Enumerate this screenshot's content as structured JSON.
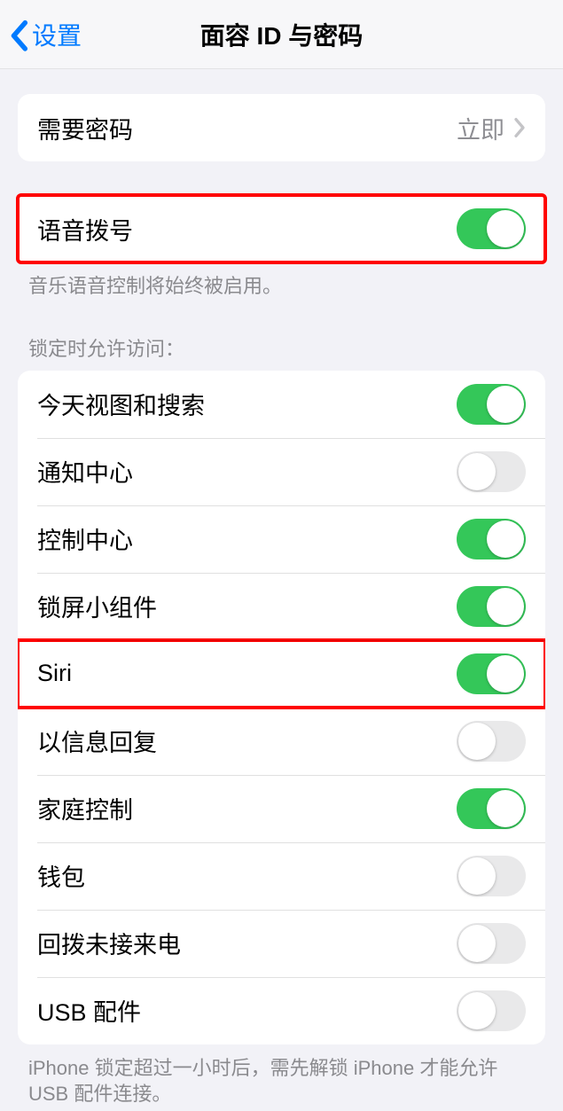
{
  "nav": {
    "back_label": "设置",
    "title": "面容 ID 与密码"
  },
  "require_passcode": {
    "label": "需要密码",
    "value": "立即"
  },
  "voice_dial": {
    "label": "语音拨号",
    "enabled": true,
    "footer": "音乐语音控制将始终被启用。"
  },
  "allow_when_locked": {
    "header": "锁定时允许访问：",
    "items": [
      {
        "label": "今天视图和搜索",
        "enabled": true
      },
      {
        "label": "通知中心",
        "enabled": false
      },
      {
        "label": "控制中心",
        "enabled": true
      },
      {
        "label": "锁屏小组件",
        "enabled": true
      },
      {
        "label": "Siri",
        "enabled": true
      },
      {
        "label": "以信息回复",
        "enabled": false
      },
      {
        "label": "家庭控制",
        "enabled": true
      },
      {
        "label": "钱包",
        "enabled": false
      },
      {
        "label": "回拨未接来电",
        "enabled": false
      },
      {
        "label": "USB 配件",
        "enabled": false
      }
    ],
    "footer": "iPhone 锁定超过一小时后，需先解锁 iPhone 才能允许USB 配件连接。"
  },
  "highlights": {
    "voice_dial_group": true,
    "siri_row_index": 4
  }
}
